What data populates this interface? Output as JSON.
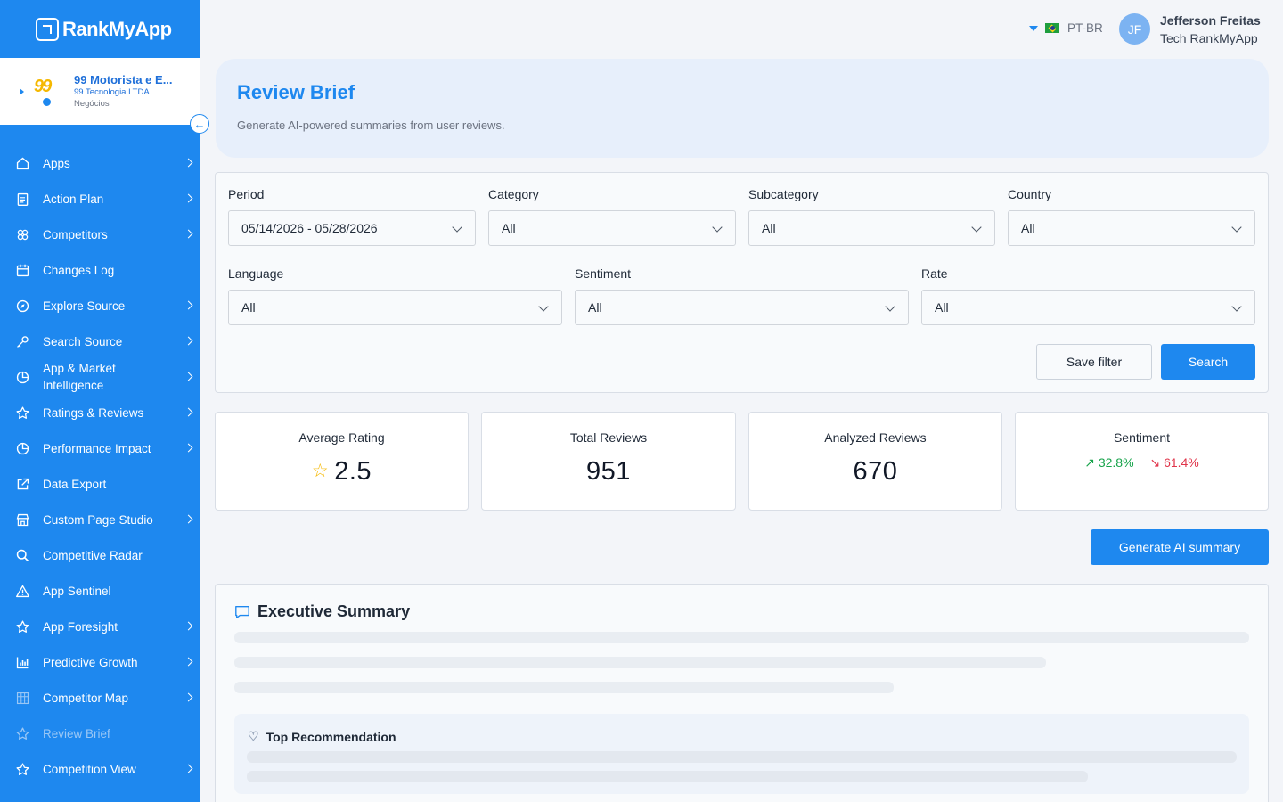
{
  "brand": {
    "name": "RankMyApp"
  },
  "app": {
    "name": "99 Motorista e E...",
    "company": "99 Tecnologia LTDA",
    "category": "Negócios"
  },
  "sidebar": {
    "items": [
      {
        "label": "Apps",
        "icon": "home-icon"
      },
      {
        "label": "Action Plan",
        "icon": "clipboard-icon"
      },
      {
        "label": "Competitors",
        "icon": "users-icon"
      },
      {
        "label": "Changes Log",
        "icon": "calendar-icon"
      },
      {
        "label": "Explore Source",
        "icon": "compass-icon"
      },
      {
        "label": "Search Source",
        "icon": "key-icon"
      },
      {
        "label": "App & Market Intelligence",
        "icon": "pie-icon"
      },
      {
        "label": "Ratings & Reviews",
        "icon": "star-icon"
      },
      {
        "label": "Performance Impact",
        "icon": "pie-icon"
      },
      {
        "label": "Data Export",
        "icon": "export-icon"
      },
      {
        "label": "Custom Page Studio",
        "icon": "store-icon"
      },
      {
        "label": "Competitive Radar",
        "icon": "search-icon"
      },
      {
        "label": "App Sentinel",
        "icon": "warning-icon"
      },
      {
        "label": "App Foresight",
        "icon": "star-icon"
      },
      {
        "label": "Predictive Growth",
        "icon": "bar-chart-icon"
      },
      {
        "label": "Competitor Map",
        "icon": "grid-icon"
      },
      {
        "label": "Review Brief",
        "icon": "star-icon"
      },
      {
        "label": "Competition View",
        "icon": "star-icon"
      }
    ]
  },
  "header": {
    "language": "PT-BR",
    "user_initials": "JF",
    "user_name": "Jefferson Freitas",
    "user_role": "Tech RankMyApp"
  },
  "hero": {
    "title": "Review Brief",
    "subtitle": "Generate AI-powered summaries from user reviews."
  },
  "filters": {
    "period_label": "Period",
    "period_value": "05/14/2026 - 05/28/2026",
    "category_label": "Category",
    "category_value": "All",
    "subcategory_label": "Subcategory",
    "subcategory_value": "All",
    "country_label": "Country",
    "country_value": "All",
    "language_label": "Language",
    "language_value": "All",
    "sentiment_label": "Sentiment",
    "sentiment_value": "All",
    "rate_label": "Rate",
    "rate_value": "All",
    "save_label": "Save filter",
    "search_label": "Search"
  },
  "stats": {
    "avg_rating_label": "Average Rating",
    "avg_rating_value": "2.5",
    "total_reviews_label": "Total Reviews",
    "total_reviews_value": "951",
    "analyzed_label": "Analyzed Reviews",
    "analyzed_value": "670",
    "sentiment_label": "Sentiment",
    "sentiment_positive": "32.8%",
    "sentiment_negative": "61.4%"
  },
  "actions": {
    "generate_label": "Generate AI summary"
  },
  "summary": {
    "title": "Executive Summary",
    "recommendation_title": "Top Recommendation"
  },
  "colors": {
    "primary": "#1e88ef",
    "positive": "#16a34a",
    "negative": "#e0344a",
    "star": "#f5b800"
  }
}
